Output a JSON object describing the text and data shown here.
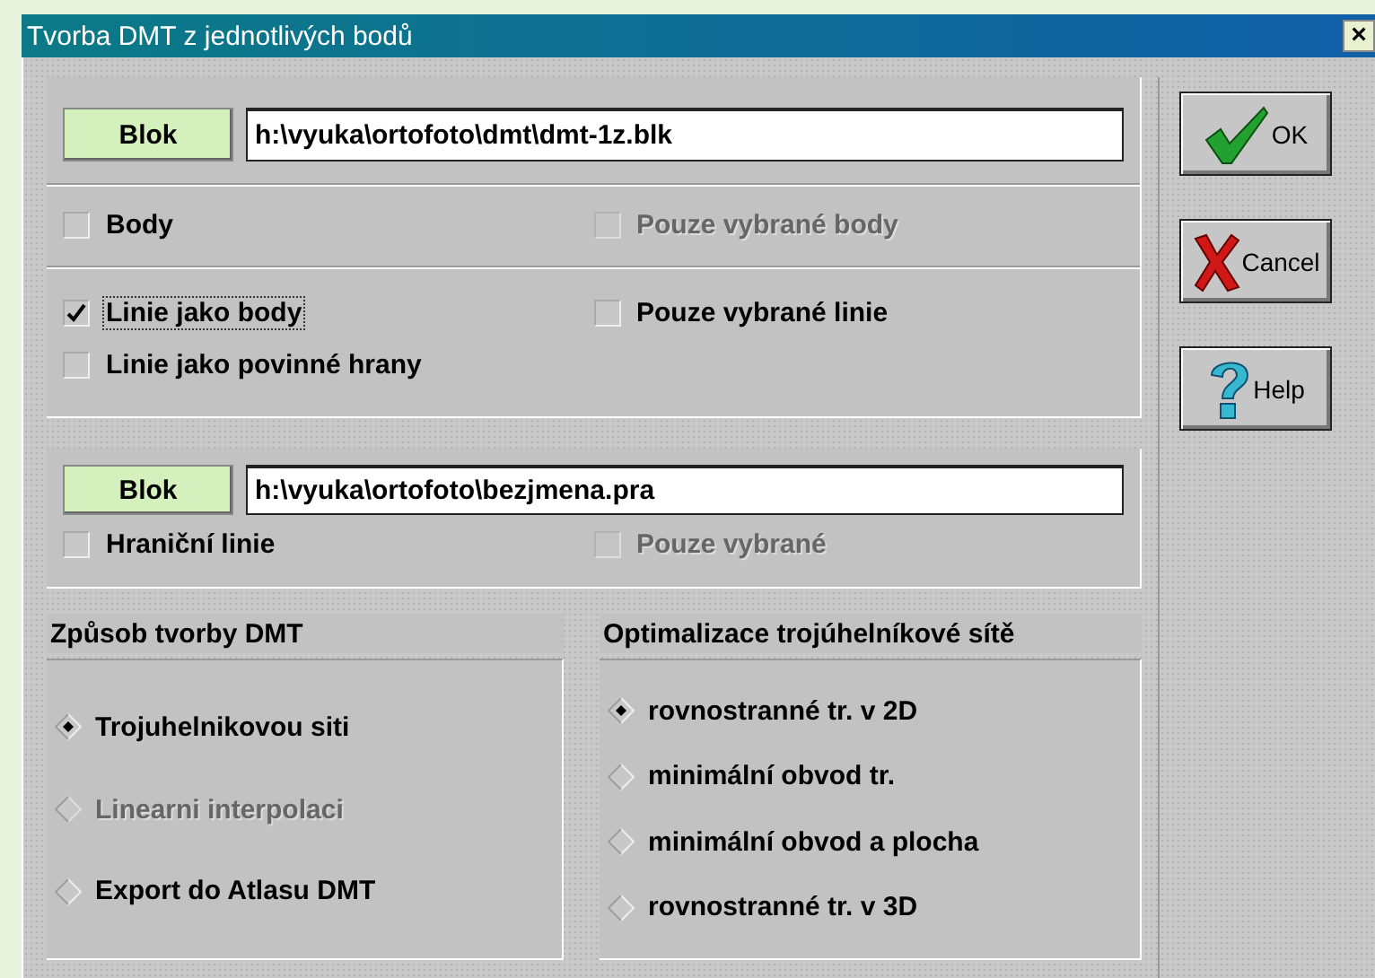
{
  "window": {
    "title": "Tvorba DMT z jednotlivých bodů",
    "close": "×"
  },
  "source": {
    "button": "Blok",
    "path": "h:\\vyuka\\ortofoto\\dmt\\dmt-1z.blk"
  },
  "point_options": [
    {
      "label": "Body",
      "checked": false,
      "disabled": false
    },
    {
      "label": "Pouze vybrané body",
      "checked": false,
      "disabled": true
    }
  ],
  "line_options": [
    {
      "label": "Linie jako body",
      "checked": true,
      "disabled": false,
      "focused": true
    },
    {
      "label": "Pouze vybrané linie",
      "checked": false,
      "disabled": false,
      "focused": false
    },
    {
      "label": "Linie jako povinné hrany",
      "checked": false,
      "disabled": false,
      "focused": false
    }
  ],
  "boundary": {
    "button": "Blok",
    "path": "h:\\vyuka\\ortofoto\\bezjmena.pra",
    "options": [
      {
        "label": "Hraniční linie",
        "checked": false,
        "disabled": false
      },
      {
        "label": "Pouze vybrané",
        "checked": false,
        "disabled": true
      }
    ]
  },
  "method": {
    "title": "Způsob tvorby DMT",
    "options": [
      {
        "label": "Trojuhelnikovou siti",
        "selected": true,
        "disabled": false
      },
      {
        "label": "Linearni interpolaci",
        "selected": false,
        "disabled": true
      },
      {
        "label": "Export do Atlasu DMT",
        "selected": false,
        "disabled": false
      }
    ]
  },
  "optimization": {
    "title": "Optimalizace trojúhelníkové sítě",
    "options": [
      {
        "label": "rovnostranné tr. v 2D",
        "selected": true,
        "disabled": false
      },
      {
        "label": "minimální obvod tr.",
        "selected": false,
        "disabled": false
      },
      {
        "label": "minimální obvod a plocha",
        "selected": false,
        "disabled": false
      },
      {
        "label": "rovnostranné tr. v 3D",
        "selected": false,
        "disabled": false
      }
    ]
  },
  "buttons": [
    {
      "kind": "ok",
      "label": "OK"
    },
    {
      "kind": "cancel",
      "label": "Cancel"
    },
    {
      "kind": "help",
      "label": "Help"
    }
  ]
}
